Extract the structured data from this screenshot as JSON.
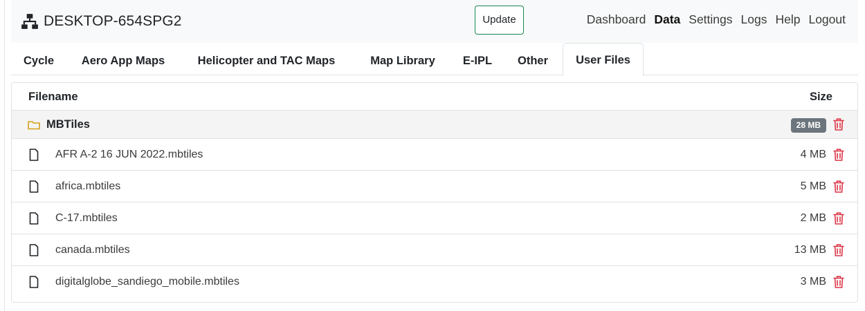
{
  "header": {
    "hostname": "DESKTOP-654SPG2",
    "update_label": "Update",
    "nav": [
      {
        "label": "Dashboard",
        "active": false
      },
      {
        "label": "Data",
        "active": true
      },
      {
        "label": "Settings",
        "active": false
      },
      {
        "label": "Logs",
        "active": false
      },
      {
        "label": "Help",
        "active": false
      },
      {
        "label": "Logout",
        "active": false
      }
    ]
  },
  "tabs": [
    {
      "label": "Cycle",
      "active": false
    },
    {
      "label": "Aero App Maps",
      "active": false
    },
    {
      "label": "Helicopter and TAC Maps",
      "active": false
    },
    {
      "label": "Map Library",
      "active": false
    },
    {
      "label": "E-IPL",
      "active": false
    },
    {
      "label": "Other",
      "active": false
    },
    {
      "label": "User Files",
      "active": true
    }
  ],
  "table": {
    "columns": {
      "filename": "Filename",
      "size": "Size"
    },
    "folder": {
      "name": "MBTiles",
      "size": "28 MB",
      "icon": "folder-icon"
    },
    "files": [
      {
        "name": "AFR A-2 16 JUN 2022.mbtiles",
        "size": "4 MB",
        "icon": "file-icon"
      },
      {
        "name": "africa.mbtiles",
        "size": "5 MB",
        "icon": "file-icon"
      },
      {
        "name": "C-17.mbtiles",
        "size": "2 MB",
        "icon": "file-icon"
      },
      {
        "name": "canada.mbtiles",
        "size": "13 MB",
        "icon": "file-icon"
      },
      {
        "name": "digitalglobe_sandiego_mobile.mbtiles",
        "size": "3 MB",
        "icon": "file-icon"
      }
    ]
  },
  "icons": {
    "brand": "network-icon",
    "delete": "trash-icon"
  },
  "colors": {
    "update_border": "#198754",
    "folder_icon": "#d4a017",
    "delete_icon": "#dc3545",
    "size_badge": "#6c757d",
    "navbar_bg": "#f8f9fa"
  }
}
